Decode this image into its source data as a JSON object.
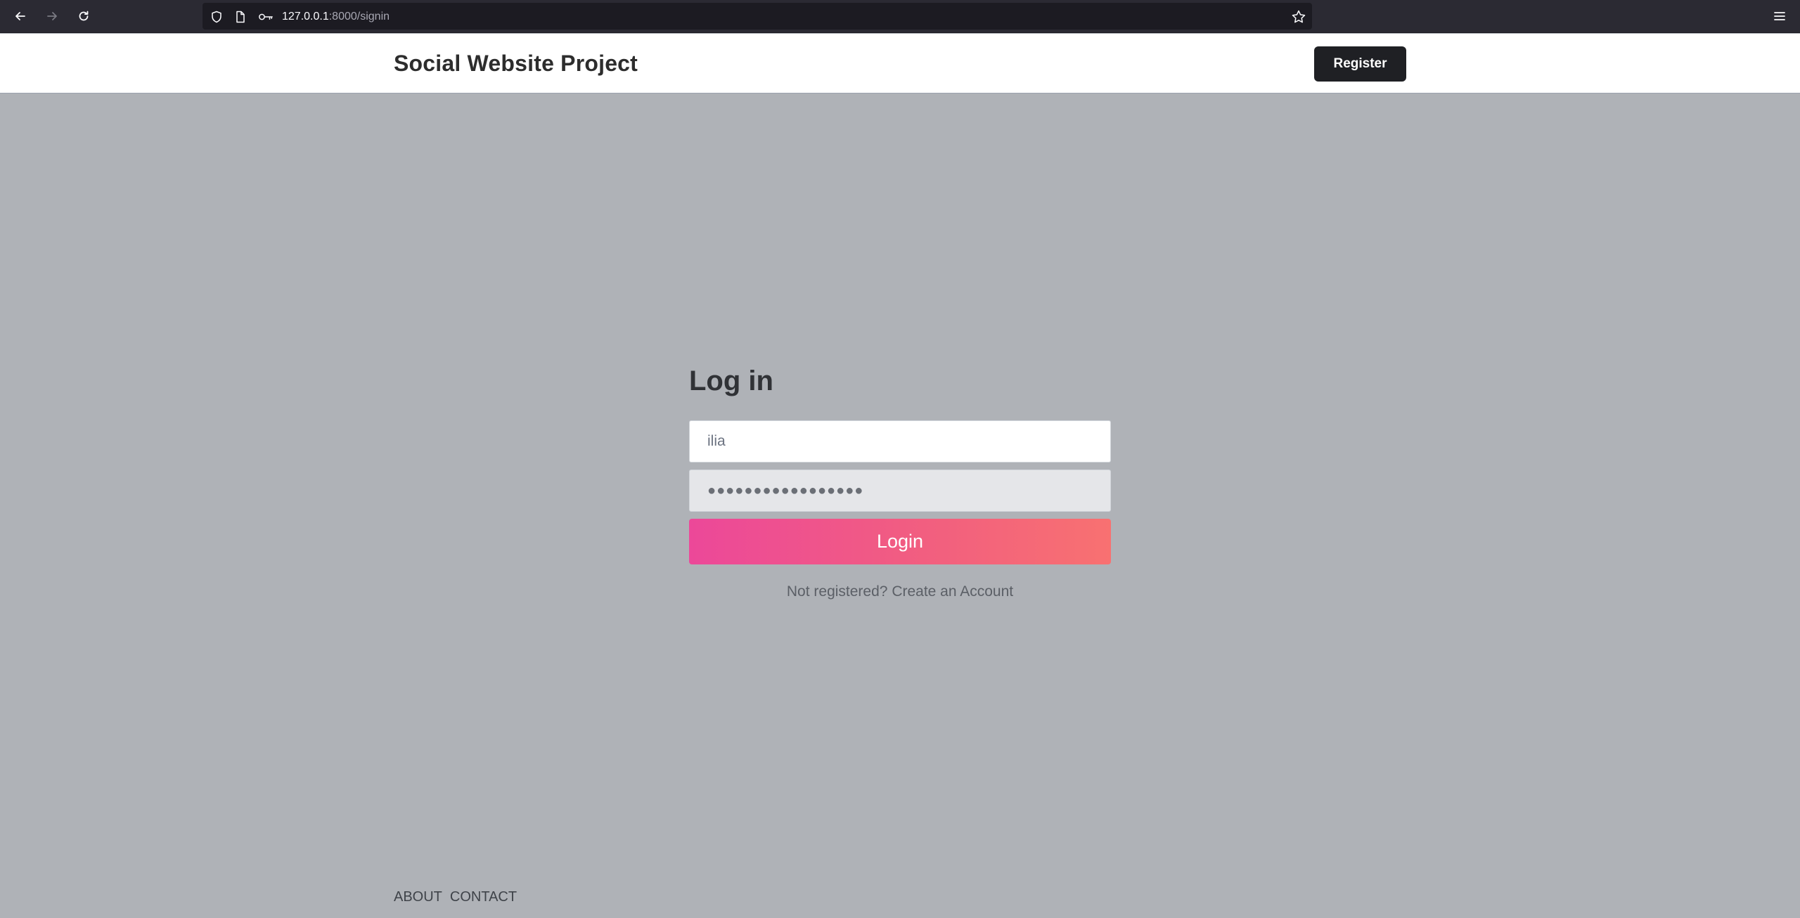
{
  "browser": {
    "url_host": "127.0.0.1",
    "url_path": ":8000/signin"
  },
  "header": {
    "brand": "Social Website Project",
    "register_label": "Register"
  },
  "login": {
    "title": "Log in",
    "username_value": "ilia",
    "password_value": "●●●●●●●●●●●●●●●●●",
    "submit_label": "Login",
    "signup_prefix": "Not registered?",
    "signup_link": "Create an Account"
  },
  "footer": {
    "links": [
      "ABOUT",
      "CONTACT"
    ]
  }
}
